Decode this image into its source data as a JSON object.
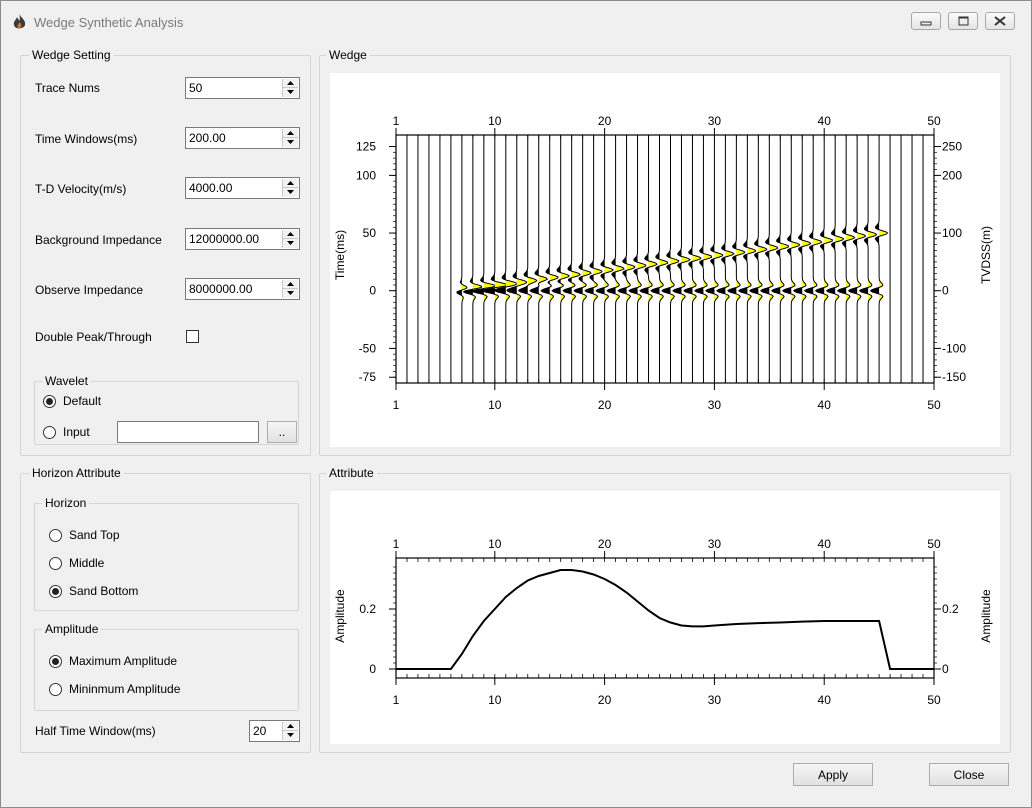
{
  "window": {
    "title": "Wedge Synthetic Analysis"
  },
  "wedge_setting": {
    "title": "Wedge Setting",
    "fields": [
      {
        "label": "Trace Nums",
        "value": "50"
      },
      {
        "label": "Time Windows(ms)",
        "value": "200.00"
      },
      {
        "label": "T-D Velocity(m/s)",
        "value": "4000.00"
      },
      {
        "label": "Background Impedance",
        "value": "12000000.00"
      },
      {
        "label": "Observe  Impedance",
        "value": "8000000.00"
      }
    ],
    "double_peak_label": "Double Peak/Through",
    "double_peak_checked": false,
    "wavelet": {
      "title": "Wavelet",
      "default_label": "Default",
      "input_label": "Input",
      "selected": "Default",
      "input_value": "",
      "browse_label": ".."
    }
  },
  "horizon_attribute": {
    "title": "Horizon Attribute",
    "horizon": {
      "title": "Horizon",
      "options": [
        "Sand Top",
        "Middle",
        "Sand Bottom"
      ],
      "selected": "Sand Bottom"
    },
    "amplitude": {
      "title": "Amplitude",
      "options": [
        "Maximum Amplitude",
        "Mininmum Amplitude"
      ],
      "selected": "Maximum Amplitude"
    },
    "half_window_label": "Half Time Window(ms)",
    "half_window_value": "20"
  },
  "wedge_panel_title": "Wedge",
  "attribute_panel_title": "Attribute",
  "buttons": {
    "apply": "Apply",
    "close": "Close"
  },
  "chart_data": [
    {
      "type": "line",
      "subtype": "seismic-wiggle-wedge",
      "title": "",
      "xlabel": "",
      "ylabel": "Time(ms)",
      "ylabel_right": "TVDSS(m)",
      "x_ticks": [
        1,
        10,
        20,
        30,
        40,
        50
      ],
      "xlim": [
        1,
        50
      ],
      "ylim": [
        -80,
        135
      ],
      "y_ticks": [
        125,
        100,
        50,
        0,
        -50,
        -75
      ],
      "y_ticks_right": [
        250,
        200,
        100,
        0,
        -100,
        -150
      ],
      "trace_count": 50,
      "wedge_start_trace": 6,
      "wedge_end_trace": 45,
      "wedge_max_thickness_ms": 50,
      "fill_colors": {
        "negative": "#000000",
        "positive": "#ffff00"
      }
    },
    {
      "type": "line",
      "title": "",
      "xlabel": "",
      "ylabel": "Amplitude",
      "ylabel_right": "Amplitude",
      "x_ticks": [
        1,
        10,
        20,
        30,
        40,
        50
      ],
      "xlim": [
        1,
        50
      ],
      "ylim": [
        -0.03,
        0.37
      ],
      "y_ticks": [
        0.2,
        0
      ],
      "series": [
        {
          "x": [
            1,
            6,
            7,
            8,
            9,
            10,
            11,
            12,
            13,
            14,
            15,
            16,
            17,
            18,
            19,
            20,
            21,
            22,
            23,
            24,
            25,
            26,
            27,
            28,
            29,
            30,
            32,
            34,
            36,
            38,
            40,
            42,
            44,
            45,
            46,
            47,
            48,
            49,
            50
          ],
          "y": [
            0,
            0,
            0.05,
            0.11,
            0.16,
            0.2,
            0.24,
            0.27,
            0.295,
            0.31,
            0.32,
            0.33,
            0.33,
            0.325,
            0.315,
            0.3,
            0.28,
            0.255,
            0.225,
            0.195,
            0.17,
            0.155,
            0.145,
            0.142,
            0.142,
            0.145,
            0.15,
            0.153,
            0.155,
            0.158,
            0.16,
            0.16,
            0.16,
            0.16,
            0,
            0,
            0,
            0,
            0
          ]
        }
      ]
    }
  ]
}
